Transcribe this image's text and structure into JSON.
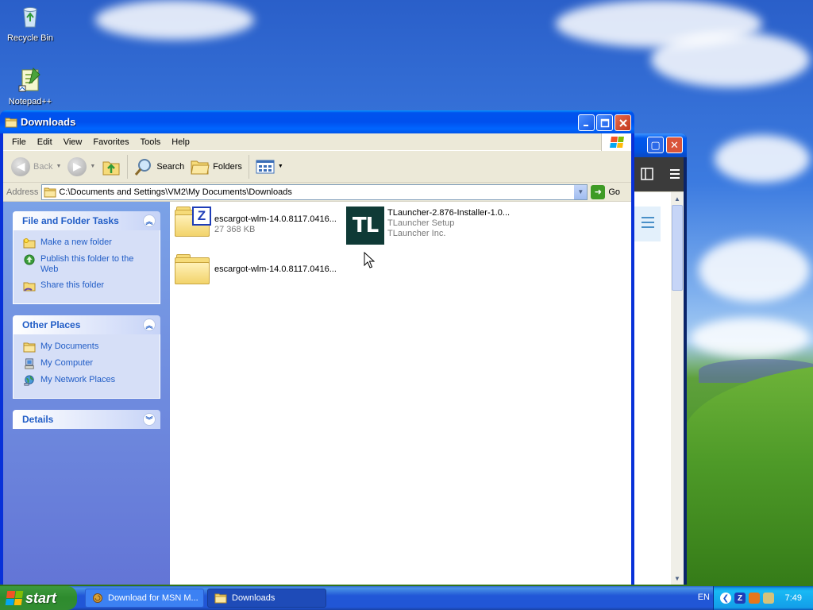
{
  "desktop": {
    "icons": [
      {
        "label": "Recycle Bin"
      },
      {
        "label": "Notepad++"
      }
    ]
  },
  "window": {
    "title": "Downloads",
    "menu": [
      "File",
      "Edit",
      "View",
      "Favorites",
      "Tools",
      "Help"
    ],
    "toolbar": {
      "back": "Back",
      "search": "Search",
      "folders": "Folders"
    },
    "address": {
      "label": "Address",
      "value": "C:\\Documents and Settings\\VM2\\My Documents\\Downloads",
      "go": "Go"
    }
  },
  "sidebar": {
    "tasks": {
      "title": "File and Folder Tasks",
      "items": [
        "Make a new folder",
        "Publish this folder to the Web",
        "Share this folder"
      ]
    },
    "places": {
      "title": "Other Places",
      "items": [
        "My Documents",
        "My Computer",
        "My Network Places"
      ]
    },
    "details": {
      "title": "Details"
    }
  },
  "files": [
    {
      "name": "escargot-wlm-14.0.8117.0416...",
      "sub1": "27 368 KB",
      "icon": "zip-folder-icon"
    },
    {
      "name": "TLauncher-2.876-Installer-1.0...",
      "sub1": "TLauncher Setup",
      "sub2": "TLauncher Inc.",
      "icon_text": "TL"
    },
    {
      "name": "escargot-wlm-14.0.8117.0416...",
      "icon": "folder-icon"
    }
  ],
  "taskbar": {
    "start": "start",
    "tasks": [
      "Download for MSN M...",
      "Downloads"
    ],
    "lang": "EN",
    "clock": "7:49"
  },
  "colors": {
    "title_blue": "#0053ee",
    "sidebar_link": "#215dc6",
    "start_green": "#2e8b2e",
    "tlauncher_bg": "#0f3a36"
  }
}
